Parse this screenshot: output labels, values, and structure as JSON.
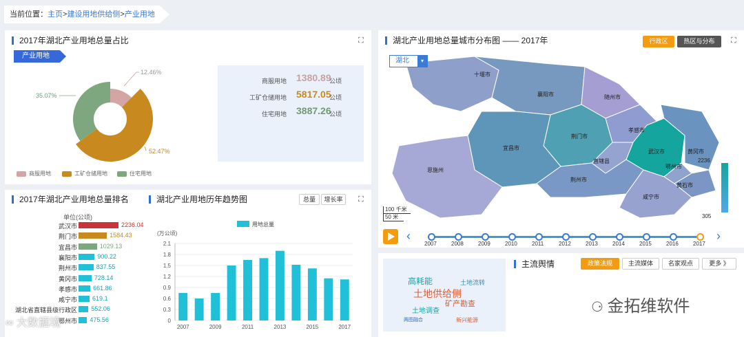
{
  "breadcrumb": {
    "prefix": "当前位置：",
    "items": [
      "主页",
      "建设用地供给侧",
      "产业用地"
    ],
    "sep": ">"
  },
  "ui": {
    "expand_icon": "⛶"
  },
  "panel1": {
    "title": "2017年湖北产业用地总量占比",
    "tag": "产业用地",
    "donut": [
      {
        "name": "商服用地",
        "pct": 12.46,
        "label": "12.46%",
        "color": "#d4a5a5"
      },
      {
        "name": "工矿仓储用地",
        "pct": 52.47,
        "label": "52.47%",
        "color": "#c8891e"
      },
      {
        "name": "住宅用地",
        "pct": 35.07,
        "label": "35.07%",
        "color": "#7ea77f"
      }
    ],
    "values": [
      {
        "label": "商服用地",
        "value": "1380.89",
        "unit": "公顷",
        "color": "#c9a19e"
      },
      {
        "label": "工矿仓储用地",
        "value": "5817.05",
        "unit": "公顷",
        "color": "#c8891e"
      },
      {
        "label": "住宅用地",
        "value": "3887.26",
        "unit": "公顷",
        "color": "#6f9a72"
      }
    ]
  },
  "panel2": {
    "title": "2017年湖北产业用地总量排名",
    "unit_label": "单位(公顷)",
    "ranking": [
      {
        "city": "武汉市",
        "value": "2236.04",
        "color": "#c9343a"
      },
      {
        "city": "荆门市",
        "value": "1584.43",
        "color": "#c8891e"
      },
      {
        "city": "宜昌市",
        "value": "1029.13",
        "color": "#7ea77f"
      },
      {
        "city": "襄阳市",
        "value": "900.22",
        "color": "#1fc0d8"
      },
      {
        "city": "荆州市",
        "value": "837.55",
        "color": "#1fc0d8"
      },
      {
        "city": "黄冈市",
        "value": "728.14",
        "color": "#1fc0d8"
      },
      {
        "city": "孝感市",
        "value": "661.86",
        "color": "#1fc0d8"
      },
      {
        "city": "咸宁市",
        "value": "619.1",
        "color": "#1fc0d8"
      },
      {
        "city": "湖北省直辖县级行政区",
        "value": "552.06",
        "color": "#1fc0d8"
      },
      {
        "city": "鄂州市",
        "value": "475.56",
        "color": "#1fc0d8"
      }
    ]
  },
  "panel3": {
    "title": "湖北产业用地历年趋势图",
    "buttons": [
      "总量",
      "增长率"
    ],
    "ylabel": "(万公顷)",
    "legend": "用地总量"
  },
  "chart_data": {
    "type": "bar",
    "series": [
      {
        "name": "用地总量",
        "values": [
          0.75,
          0.6,
          0.75,
          1.5,
          1.65,
          1.7,
          1.9,
          1.52,
          1.42,
          1.15,
          1.12
        ],
        "color": "#1fc0d8"
      }
    ],
    "categories": [
      "2007",
      "2008",
      "2009",
      "2010",
      "2011",
      "2012",
      "2013",
      "2014",
      "2015",
      "2016",
      "2017"
    ],
    "xtick_labels": [
      "2007",
      "2009",
      "2011",
      "2013",
      "2015",
      "2017"
    ],
    "yticks": [
      "0",
      "0.3",
      "0.6",
      "0.9",
      "1.2",
      "1.5",
      "1.8",
      "2.1"
    ],
    "ylim": [
      0,
      2.1
    ],
    "ylabel": "(万公顷)",
    "grid": true,
    "legend_position": "top"
  },
  "map": {
    "title": "湖北产业用地总量城市分布图 —— 2017年",
    "tabs": [
      {
        "label": "行政区",
        "active": true
      },
      {
        "label": "热区与分布",
        "active": false
      }
    ],
    "dropdown": "湖北",
    "cities": [
      "十堰市",
      "襄阳市",
      "随州市",
      "荆门市",
      "孝感市",
      "宜昌市",
      "恩施州",
      "武汉市",
      "黄冈市",
      "直辖县",
      "鄂州市",
      "荆州市",
      "黄石市",
      "咸宁市"
    ],
    "scale_max": "2236",
    "scale_min": "305",
    "scalebar": [
      "100 千米",
      "50 米"
    ],
    "timeline": [
      "2007",
      "2008",
      "2009",
      "2010",
      "2011",
      "2012",
      "2013",
      "2014",
      "2015",
      "2016",
      "2017"
    ],
    "current_year": "2017"
  },
  "news": {
    "title": "主流舆情",
    "tabs": [
      {
        "label": "政策法规",
        "active": true
      },
      {
        "label": "主流媒体",
        "active": false
      },
      {
        "label": "名家观点",
        "active": false
      }
    ],
    "more": "更多 》",
    "words": [
      {
        "text": "高耗能",
        "color": "#1aa3a3"
      },
      {
        "text": "土地流转",
        "color": "#3a8fb5"
      },
      {
        "text": "土地供给侧",
        "color": "#d9603b"
      },
      {
        "text": "矿产勘查",
        "color": "#c9623a"
      },
      {
        "text": "土地调查",
        "color": "#1aa3a3"
      },
      {
        "text": "两图融合",
        "color": "#2f6fd8"
      },
      {
        "text": "新兴能源",
        "color": "#d9603b"
      }
    ]
  },
  "watermarks": [
    "大数据境",
    "金拓维软件"
  ]
}
